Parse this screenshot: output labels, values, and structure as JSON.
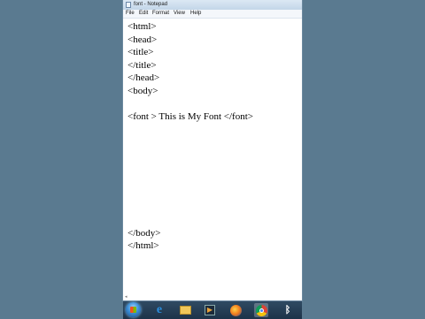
{
  "window": {
    "title": "font - Notepad"
  },
  "menu": [
    "File",
    "Edit",
    "Format",
    "View",
    "Help"
  ],
  "editor": {
    "lines": [
      "<html>",
      "<head>",
      "<title>",
      "</title>",
      "</head>",
      "<body>",
      "",
      "<font > This is My Font </font>",
      "",
      "",
      "",
      "",
      "",
      "",
      "",
      "",
      "</body>",
      "</html>"
    ]
  },
  "taskbar": {
    "items": [
      {
        "name": "start-orb",
        "icon": "windows-start-icon"
      },
      {
        "name": "ie",
        "icon": "internet-explorer-icon",
        "glyph": "e",
        "color": "#2a8fe0"
      },
      {
        "name": "explorer",
        "icon": "folder-icon",
        "glyph": "▤",
        "color": "#f0c75a"
      },
      {
        "name": "media",
        "icon": "media-player-icon",
        "glyph": "▶",
        "color": "#e8a23a"
      },
      {
        "name": "firefox",
        "icon": "firefox-icon",
        "glyph": "●",
        "color": "#e8661c"
      },
      {
        "name": "chrome",
        "icon": "chrome-icon",
        "glyph": "◉",
        "color": "#4caf50"
      },
      {
        "name": "bluetooth",
        "icon": "bluetooth-icon",
        "glyph": "ᛒ",
        "color": "#ffffff"
      }
    ]
  }
}
